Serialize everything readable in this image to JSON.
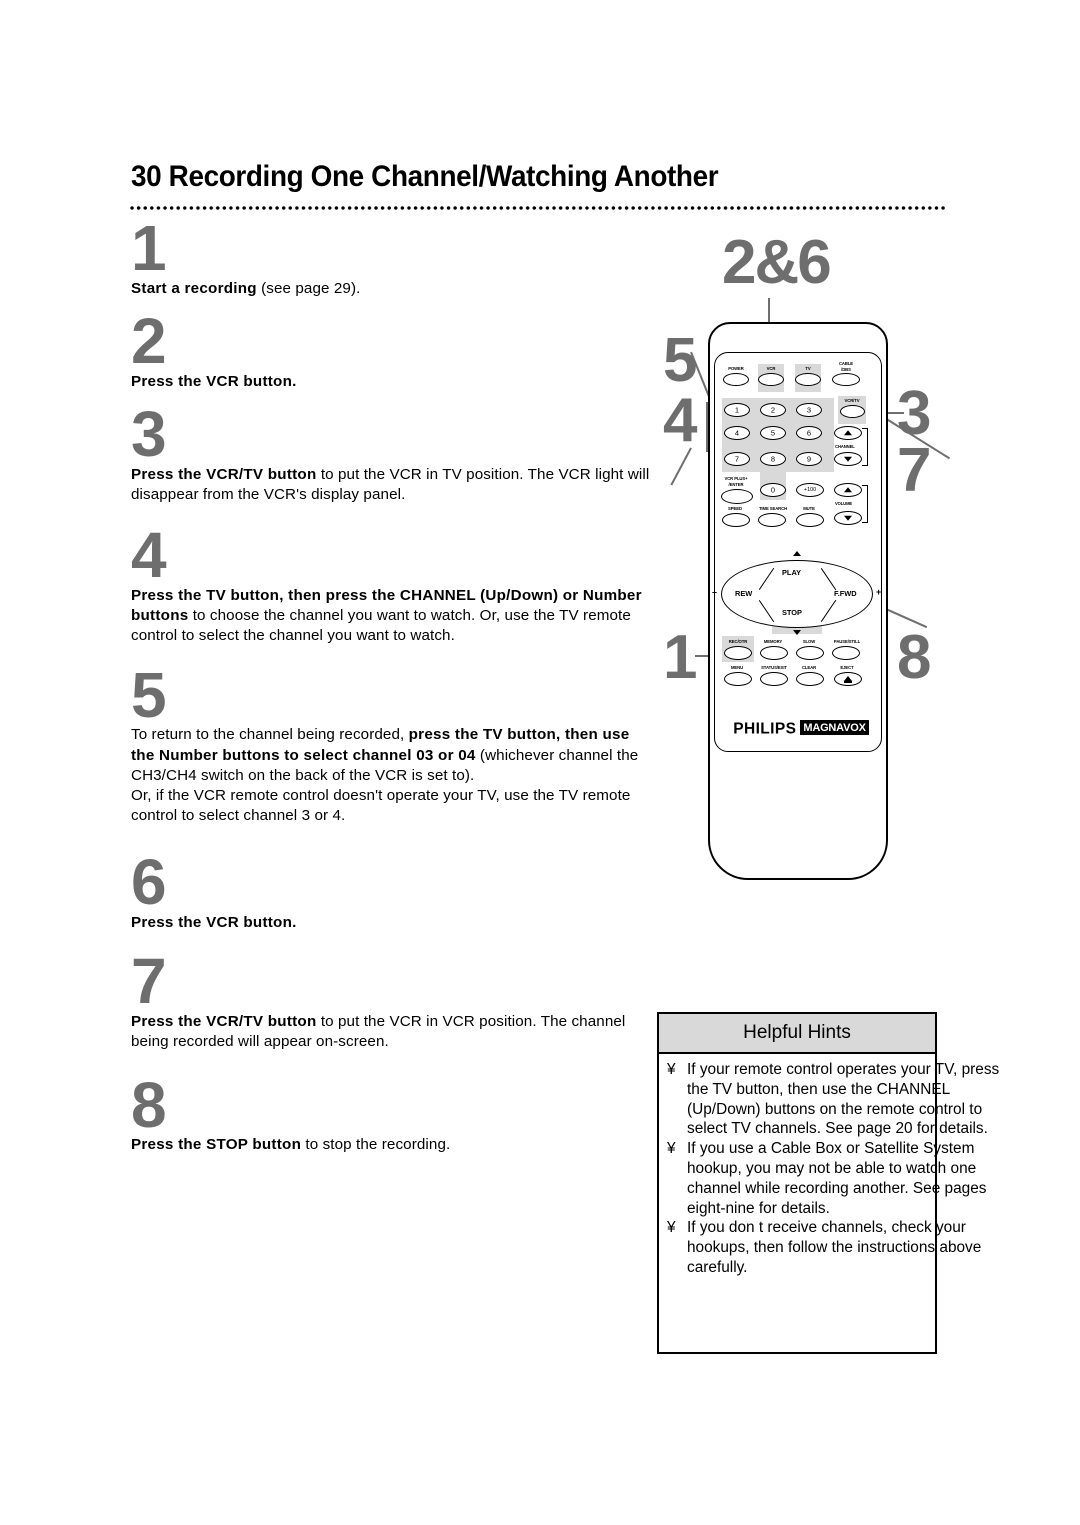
{
  "header": {
    "page_number": "30",
    "title": "30  Recording One Channel/Watching Another"
  },
  "steps": [
    {
      "number": "1",
      "text_html": "<b>Start a recording</b> (see page 29)."
    },
    {
      "number": "2",
      "text_html": "<b>Press the VCR button.</b>"
    },
    {
      "number": "3",
      "text_html": "<b>Press the VCR/TV button</b> to put the VCR in TV position. The VCR light will disappear from the VCR's display panel."
    },
    {
      "number": "4",
      "text_html": "<b>Press the TV button, then press the CHANNEL (Up/Down) or Number buttons</b> to choose the channel you want to watch. Or, use the TV remote control to select the channel you want to watch."
    },
    {
      "number": "5",
      "text_html": "To return to the channel being recorded, <b>press the TV button, then use the Number buttons to select channel 03 or 04</b> (whichever channel the CH3/CH4 switch on the back of the VCR is set to).<br>Or, if the VCR remote control doesn't operate your TV, use the TV remote control to select channel 3 or 4."
    },
    {
      "number": "6",
      "text_html": "<b>Press the VCR button.</b>"
    },
    {
      "number": "7",
      "text_html": "<b>Press the VCR/TV button</b> to put the VCR in VCR position. The channel being recorded will appear on-screen."
    },
    {
      "number": "8",
      "text_html": "<b>Press the STOP button</b> to stop the recording."
    }
  ],
  "callouts": [
    {
      "id": "co-26",
      "label": "2&6",
      "points_to": "VCR button"
    },
    {
      "id": "co-5",
      "label": "5",
      "points_to": "Number buttons"
    },
    {
      "id": "co-4",
      "label": "4",
      "points_to": "TV button"
    },
    {
      "id": "co-3",
      "label": "3",
      "points_to": "VCR/TV button"
    },
    {
      "id": "co-7",
      "label": "7",
      "points_to": "VCR/TV button"
    },
    {
      "id": "co-1",
      "label": "1",
      "points_to": "REC/OTR button"
    },
    {
      "id": "co-8",
      "label": "8",
      "points_to": "STOP button"
    }
  ],
  "remote": {
    "brand_primary": "PHILIPS",
    "brand_secondary": "MAGNAVOX",
    "top_row": [
      "POWER",
      "VCR",
      "TV",
      "CABLE\n/DBS"
    ],
    "buttons": {
      "power": "POWER",
      "vcr": "VCR",
      "tv": "TV",
      "cable_dbs_line1": "CABLE",
      "cable_dbs_line2": "/DBS",
      "vcr_tv": "VCR/TV",
      "vcr_plus_line1": "VCR PLUS+",
      "vcr_plus_line2": "/ENTER",
      "plus100": "+100",
      "speed": "SPEED",
      "time_search": "TIME SEARCH",
      "mute": "MUTE",
      "rec_otr": "REC/OTR",
      "memory": "MEMORY",
      "slow": "SLOW",
      "pause_still": "PAUSE/STILL",
      "menu": "MENU",
      "status_exit": "STATUS/EXIT",
      "clear": "CLEAR",
      "eject": "EJECT"
    },
    "keypad": [
      "1",
      "2",
      "3",
      "4",
      "5",
      "6",
      "7",
      "8",
      "9",
      "0"
    ],
    "group_labels": {
      "channel": "CHANNEL",
      "volume": "VOLUME"
    },
    "transport": {
      "play": "PLAY",
      "rew": "REW",
      "ffwd": "F.FWD",
      "stop": "STOP",
      "minus": "–",
      "plus": "+"
    }
  },
  "hints": {
    "heading": "Helpful Hints",
    "bullet_glyph": "¥",
    "items": [
      "If your remote control operates your TV, press the TV button, then use the CHANNEL (Up/Down) buttons on the remote control to select TV channels. See page 20 for details.",
      "If you use a Cable Box or Satellite System hookup, you may not be able to watch one channel while recording another. See pages eight-nine for details.",
      "If you don t receive channels, check your hookups, then follow the instructions above carefully."
    ]
  },
  "colors": {
    "step_number": "#6e6e6e",
    "shade": "#d9d9d9",
    "text": "#000000",
    "background": "#ffffff"
  }
}
